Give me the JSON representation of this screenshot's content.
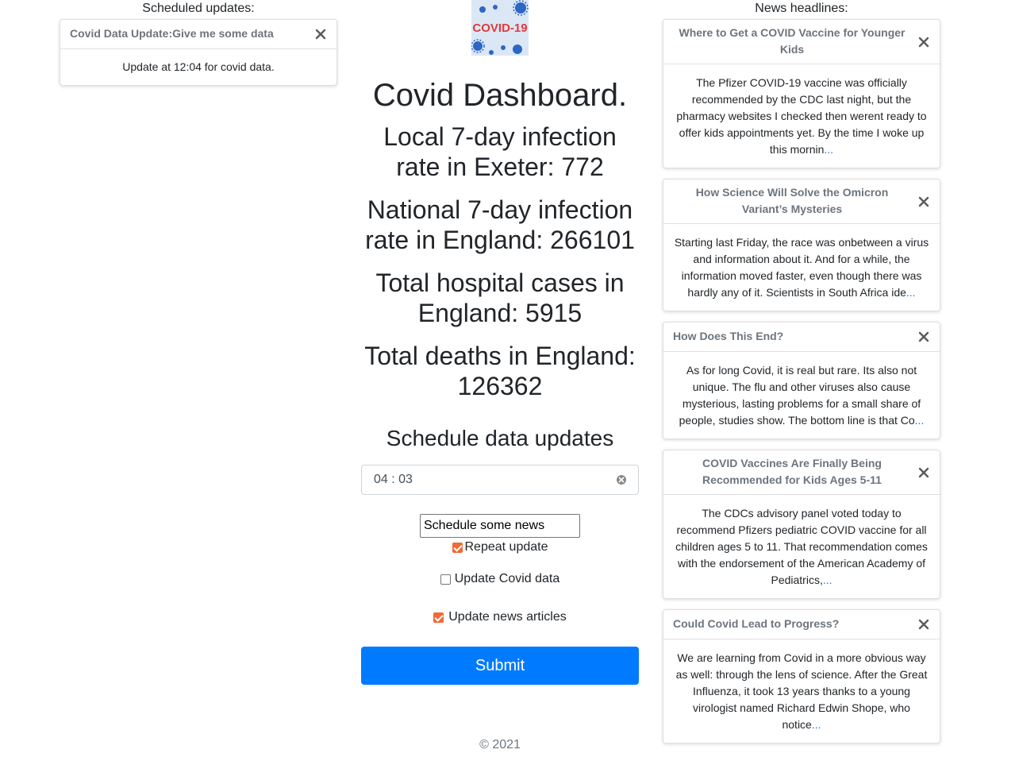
{
  "left": {
    "heading": "Scheduled updates:",
    "cards": [
      {
        "title": "Covid Data Update:Give me some data",
        "body": "Update at 12:04 for covid data."
      }
    ]
  },
  "main": {
    "logo_text": "COVID-19",
    "title": "Covid Dashboard.",
    "stats": [
      "Local 7-day infection rate in Exeter: 772",
      "National 7-day infection rate in England: 266101",
      "Total hospital cases in England: 5915",
      "Total deaths in England: 126362"
    ],
    "schedule_title": "Schedule data updates",
    "time_value": "04 : 03",
    "name_value": "Schedule some news",
    "repeat_label": "Repeat update",
    "covid_label": "Update Covid data",
    "news_label": "Update news articles",
    "submit_label": "Submit"
  },
  "right": {
    "heading": "News headlines:",
    "articles": [
      {
        "title": "Where to Get a COVID Vaccine for Younger Kids",
        "body": "The Pfizer COVID-19 vaccine was officially recommended by the CDC last night, but the pharmacy websites I checked then werent ready to offer kids appointments yet. By the time I woke up this mornin",
        "more": "..."
      },
      {
        "title": "How Science Will Solve the Omicron Variant’s Mysteries",
        "body": "Starting last Friday, the race was onbetween a virus and information about it. And for a while, the information moved faster, even though there was hardly any of it. Scientists in South Africa ide",
        "more": "..."
      },
      {
        "title": "How Does This End?",
        "body": "As for long Covid, it is real but rare. Its also not unique. The flu and other viruses also cause mysterious, lasting problems for a small share of people, studies show. The bottom line is that Co",
        "more": "..."
      },
      {
        "title": "COVID Vaccines Are Finally Being Recommended for Kids Ages 5-11",
        "body": "The CDCs advisory panel voted today to recommend Pfizers pediatric COVID vaccine for all children ages 5 to 11. That recommendation comes with the endorsement of the American Academy of Pediatrics,",
        "more": "..."
      },
      {
        "title": "Could Covid Lead to Progress?",
        "body": "We are learning from Covid in a more obvious way as well: through the lens of science. After the Great Influenza, it took 13 years thanks to a young virologist named Richard Edwin Shope, who notice",
        "more": "..."
      }
    ]
  },
  "footer": "© 2021",
  "colors": {
    "accent": "#007bff",
    "checkbox": "#f06a35",
    "link": "#1a73e8"
  },
  "icons": {
    "close": "close-icon",
    "clear": "clear-icon"
  }
}
